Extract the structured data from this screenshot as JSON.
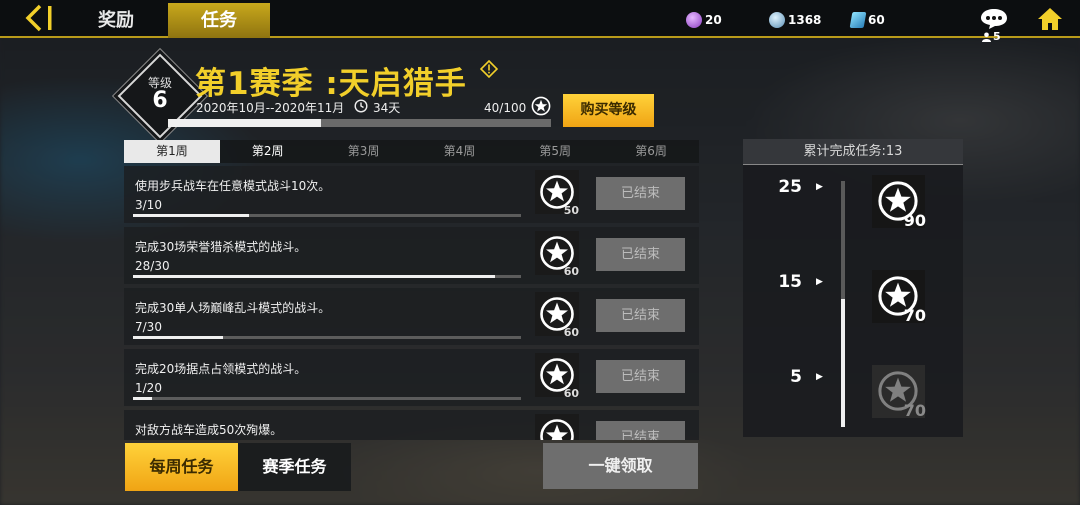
{
  "topbar": {
    "tabs": [
      {
        "label": "奖励",
        "active": false
      },
      {
        "label": "任务",
        "active": true
      }
    ],
    "currencies": [
      {
        "icon": "purple-gem-icon",
        "value": "20"
      },
      {
        "icon": "silver-coin-icon",
        "value": "1368"
      },
      {
        "icon": "blue-card-icon",
        "value": "60"
      }
    ],
    "chat_count": "5",
    "icons": {
      "back": "back-arrow-icon",
      "chat": "chat-bubble-icon",
      "home": "home-icon"
    }
  },
  "season": {
    "level_label": "等级",
    "level": "6",
    "title": "第1赛季 :天启猎手",
    "dates": "2020年10月--2020年11月",
    "days_left": "34天",
    "xp": "40/100",
    "xp_fraction": 0.4,
    "buy_label": "购买等级"
  },
  "weeks": [
    {
      "label": "第1周",
      "active": true
    },
    {
      "label": "第2周",
      "active": false
    },
    {
      "label": "第3周",
      "active": false
    },
    {
      "label": "第4周",
      "active": false
    },
    {
      "label": "第5周",
      "active": false
    },
    {
      "label": "第6周",
      "active": false
    }
  ],
  "tasks": [
    {
      "desc": "使用步兵战车在任意模式战斗10次。",
      "progress": "3/10",
      "fraction": 0.3,
      "reward": "50",
      "status": "已结束"
    },
    {
      "desc": "完成30场荣誉猎杀模式的战斗。",
      "progress": "28/30",
      "fraction": 0.933,
      "reward": "60",
      "status": "已结束"
    },
    {
      "desc": "完成30单人场巅峰乱斗模式的战斗。",
      "progress": "7/30",
      "fraction": 0.233,
      "reward": "60",
      "status": "已结束"
    },
    {
      "desc": "完成20场据点占领模式的战斗。",
      "progress": "1/20",
      "fraction": 0.05,
      "reward": "60",
      "status": "已结束"
    },
    {
      "desc": "对敌方战车造成50次殉爆。",
      "progress": "",
      "fraction": 0,
      "reward": "",
      "status": "已结束"
    }
  ],
  "bottom": {
    "weekly_label": "每周任务",
    "season_label": "赛季任务",
    "claim_label": "一键领取"
  },
  "cumulative": {
    "title": "累计完成任务:13",
    "completed": 13,
    "milestones": [
      {
        "count": "25",
        "reward": "90",
        "reached": false
      },
      {
        "count": "15",
        "reward": "70",
        "reached": false
      },
      {
        "count": "5",
        "reward": "70",
        "reached": true
      }
    ]
  },
  "colors": {
    "accent": "#f2cf2a",
    "button_yellow": "#f5b820",
    "disabled": "#6e6e6e"
  }
}
